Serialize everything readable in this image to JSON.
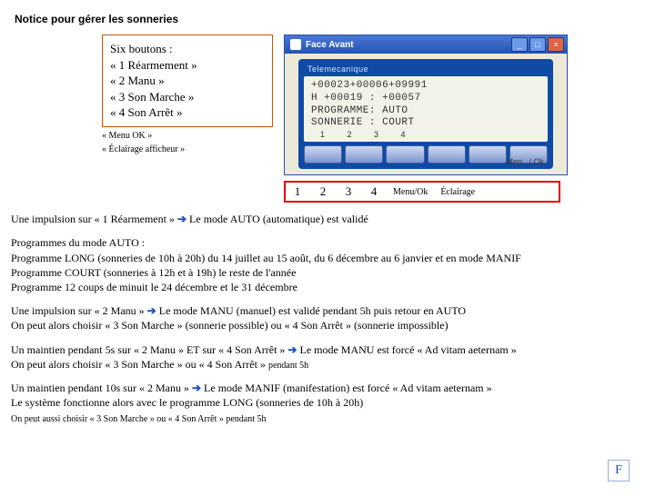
{
  "title": "Notice pour gérer les sonneries",
  "box": {
    "heading": "Six boutons :",
    "lines": [
      "« 1 Réarmement »",
      "« 2 Manu »",
      "« 3 Son Marche »",
      "« 4 Son Arrêt »"
    ],
    "small1": "« Menu OK »",
    "small2": "« Éclairage afficheur »"
  },
  "win": {
    "title": "Face Avant",
    "min": "_",
    "max": "□",
    "close": "×"
  },
  "device": {
    "brand": "Telemecanique",
    "lcd_l1": "+00023+00006+09991",
    "lcd_l2": "H +00019 : +00057",
    "lcd_l3": "PROGRAMME: AUTO",
    "lcd_l4": "SONNERIE : COURT",
    "foot1": "1",
    "foot2": "2",
    "foot3": "3",
    "foot4": "4",
    "hint": "Men.. / Ok"
  },
  "labels": {
    "n1": "1",
    "n2": "2",
    "n3": "3",
    "n4": "4",
    "menu": "Menu/Ok",
    "eclair": "Éclairage"
  },
  "p1_a": "Une impulsion sur « 1 Réarmement » ",
  "p1_b": " Le mode AUTO (automatique) est validé",
  "p2_h": "Programmes du mode AUTO :",
  "p2_1": "Programme LONG (sonneries de 10h à 20h) du 14 juillet au 15 août, du 6 décembre au 6 janvier et en mode MANIF",
  "p2_2": "Programme COURT (sonneries à 12h et à 19h) le reste de l'année",
  "p2_3": "Programme 12 coups de minuit le 24 décembre et le 31 décembre",
  "p3_a": "Une impulsion sur « 2 Manu » ",
  "p3_b": " Le mode MANU (manuel) est validé pendant 5h puis retour en AUTO",
  "p3_c": "On peut alors choisir « 3 Son Marche » (sonnerie possible) ou « 4 Son Arrêt » (sonnerie impossible)",
  "p4_a": "Un maintien pendant 5s sur « 2 Manu » ET sur « 4 Son Arrêt » ",
  "p4_b": " Le mode MANU est forcé « Ad vitam aeternam »",
  "p4_c_a": "On peut alors choisir « 3 Son Marche » ou « 4 Son Arrêt » ",
  "p4_c_b": "pendant 5h",
  "p5_a": "Un maintien pendant 10s sur « 2 Manu »  ",
  "p5_b": " Le mode MANIF (manifestation) est forcé « Ad vitam aeternam »",
  "p5_c": "Le système fonctionne alors avec le programme LONG (sonneries de 10h à 20h)",
  "p5_d": "On peut aussi choisir « 3 Son Marche » ou « 4 Son Arrêt » pendant 5h",
  "arrow": "➔",
  "page_letter": "F"
}
